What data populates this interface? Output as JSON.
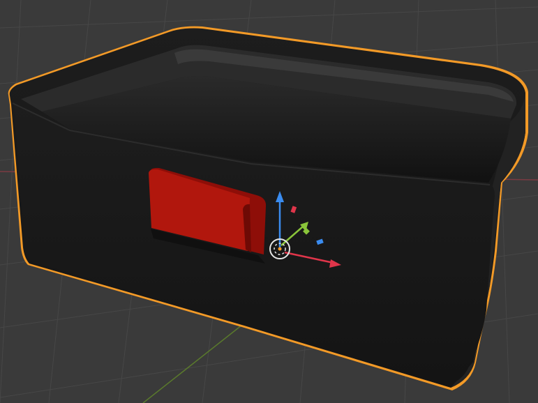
{
  "viewport": {
    "background": "#3a3a3a",
    "grid_color": "#4a4a4a",
    "x_axis_color": "#8a3b43",
    "y_axis_color": "#5d7a2a"
  },
  "object": {
    "name": "box",
    "body_color": "#1b1b1b",
    "selection_outline_color": "#f39a27",
    "cutout_color": "#a3150d"
  },
  "gizmo": {
    "x_color": "#e0354a",
    "y_color": "#8ac53a",
    "z_color": "#3a8cf0",
    "origin_icon": "3d-cursor-icon"
  }
}
